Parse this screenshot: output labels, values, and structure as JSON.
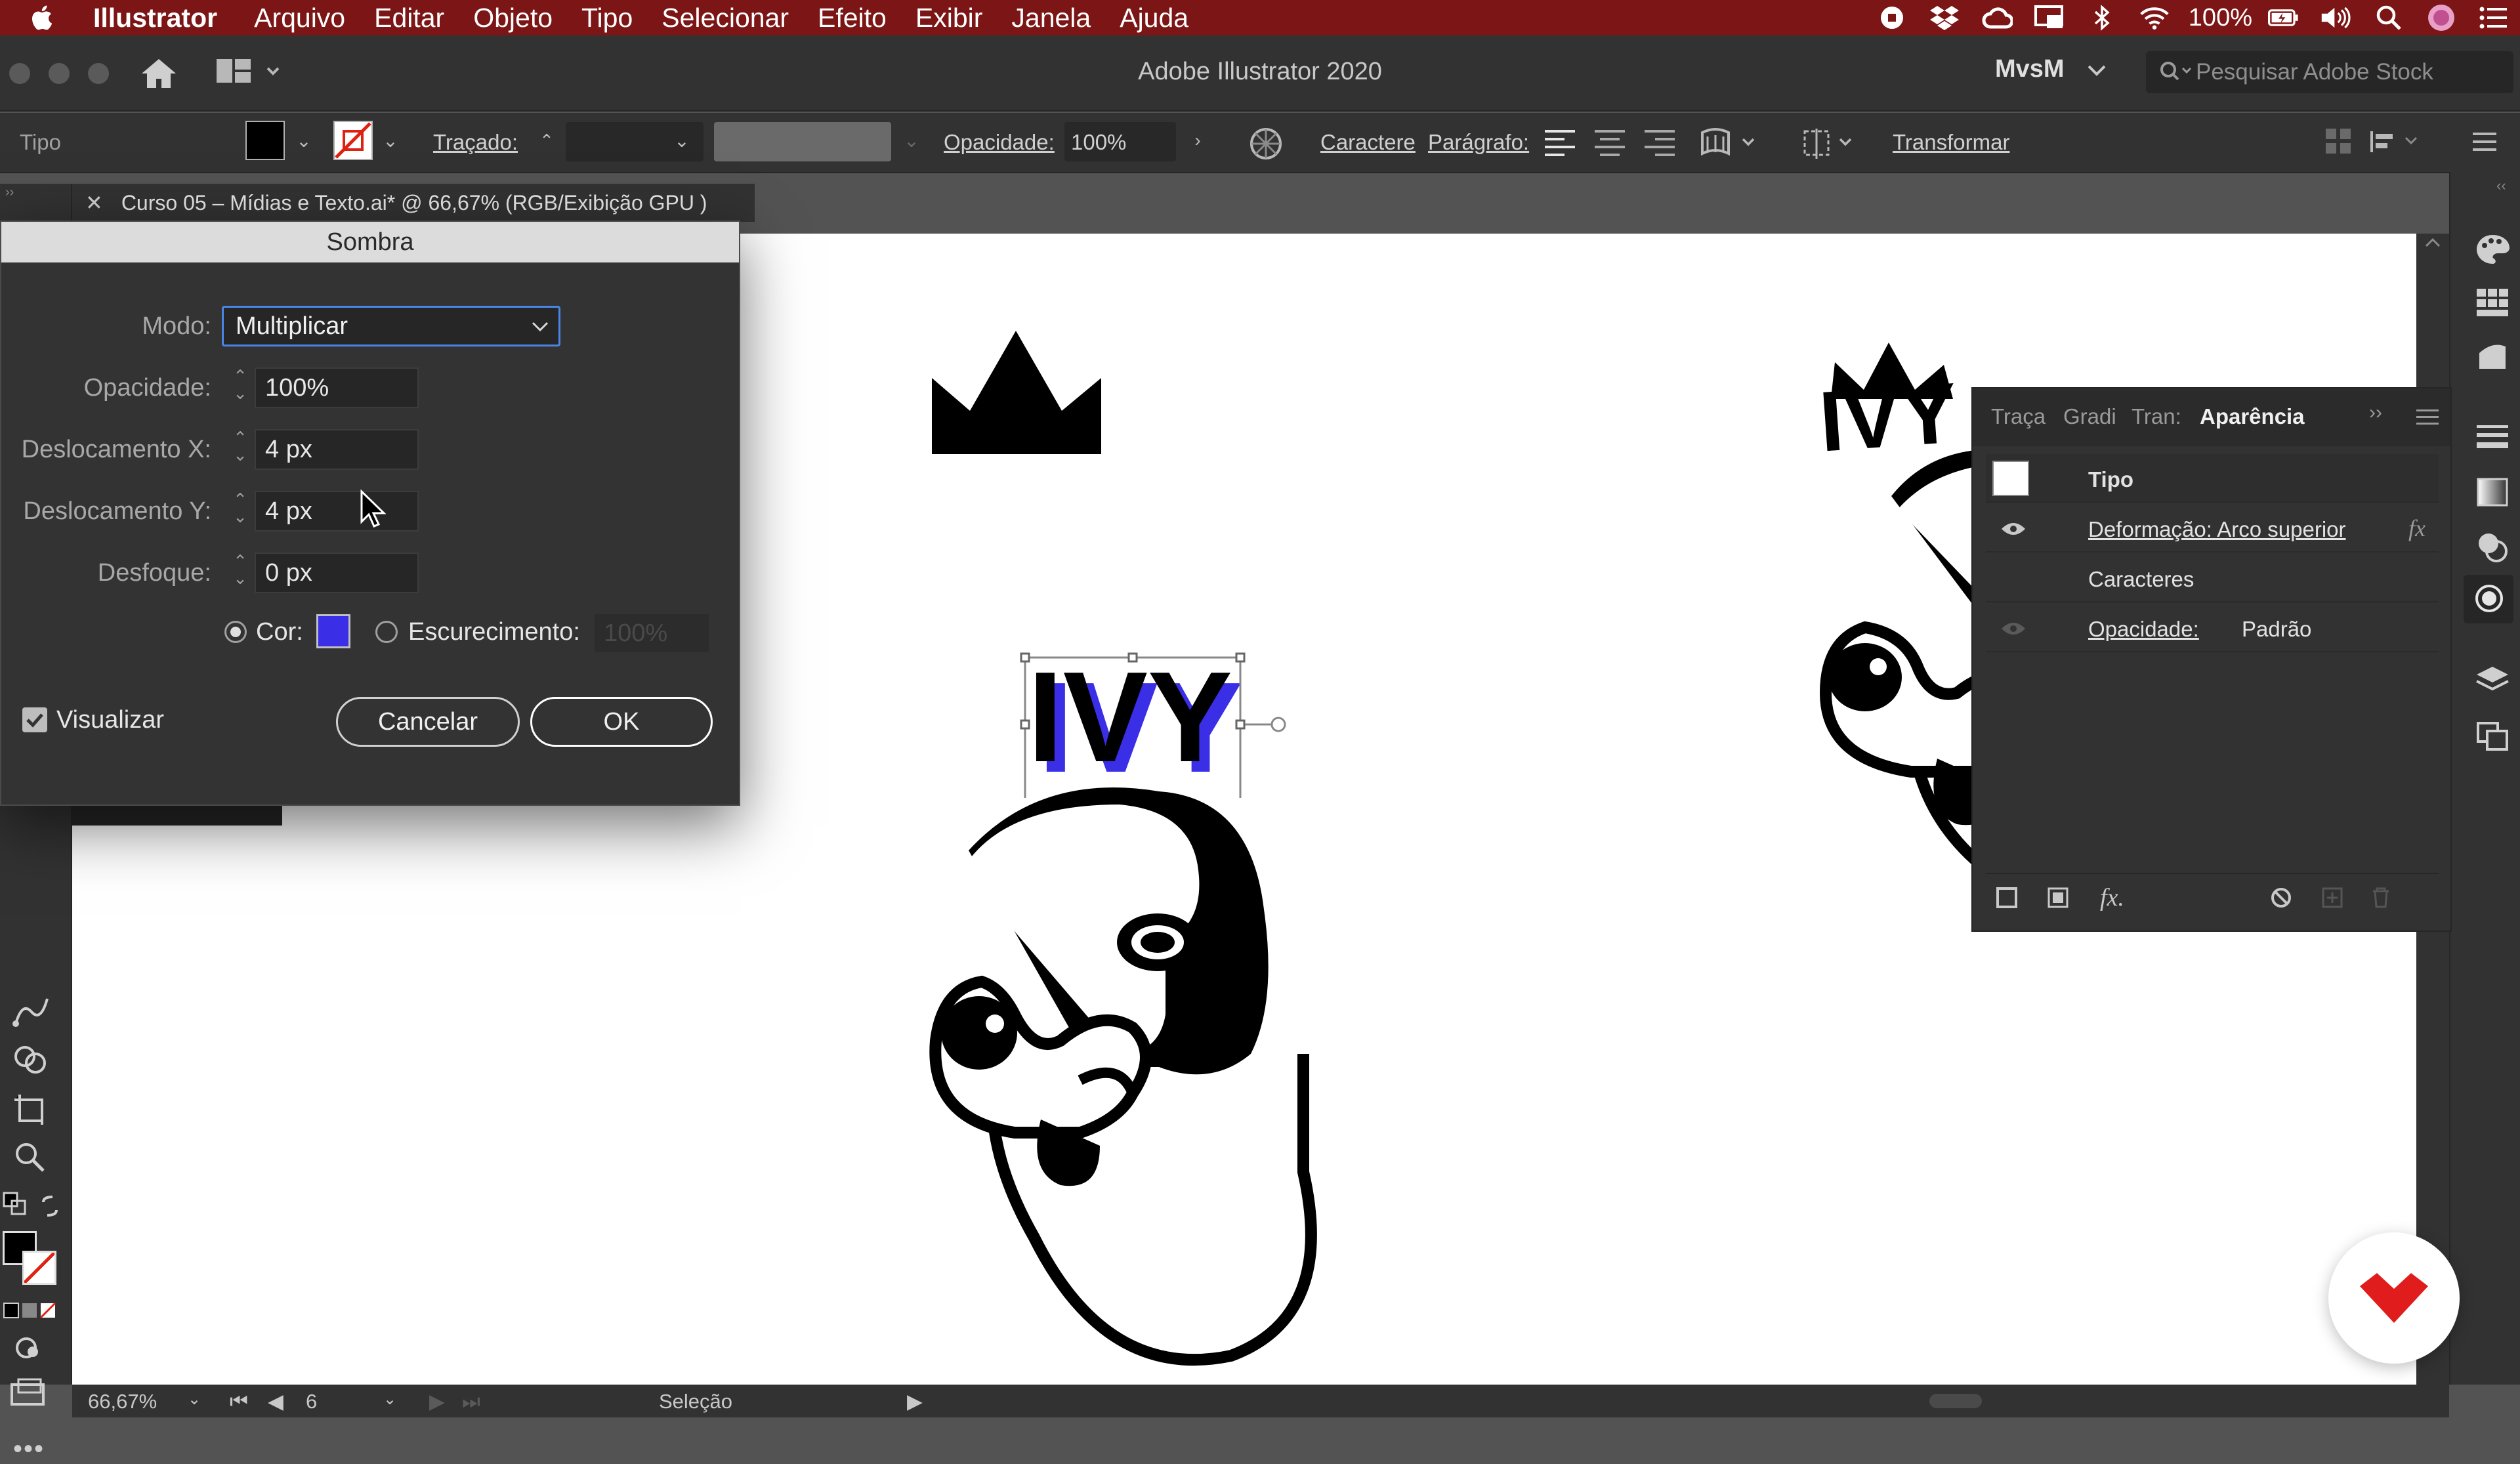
{
  "menubar": {
    "app_name": "Illustrator",
    "items": [
      "Arquivo",
      "Editar",
      "Objeto",
      "Tipo",
      "Selecionar",
      "Efeito",
      "Exibir",
      "Janela",
      "Ajuda"
    ],
    "battery": "100%"
  },
  "appbar": {
    "title": "Adobe Illustrator 2020",
    "workspace": "MvsM",
    "stock_search_placeholder": "Pesquisar Adobe Stock"
  },
  "controlbar": {
    "selection_type": "Tipo",
    "stroke_label": "Traçado:",
    "opacity_label": "Opacidade:",
    "opacity_value": "100%",
    "character_link": "Caractere",
    "paragraph_link": "Parágrafo:",
    "transform_link": "Transformar",
    "fill_color": "#000000"
  },
  "document_tab": {
    "close": "✕",
    "title": "Curso 05 – Mídias e Texto.ai* @ 66,67% (RGB/Exibição GPU )"
  },
  "dialog": {
    "title": "Sombra",
    "mode_label": "Modo:",
    "mode_value": "Multiplicar",
    "opacity_label": "Opacidade:",
    "opacity_value": "100%",
    "offset_x_label": "Deslocamento X:",
    "offset_x_value": "4 px",
    "offset_y_label": "Deslocamento Y:",
    "offset_y_value": "4 px",
    "blur_label": "Desfoque:",
    "blur_value": "0 px",
    "color_label": "Cor:",
    "color_value": "#3a2ee6",
    "color_selected": true,
    "darkness_label": "Escurecimento:",
    "darkness_value": "100%",
    "preview_label": "Visualizar",
    "preview_checked": true,
    "cancel_label": "Cancelar",
    "ok_label": "OK"
  },
  "appearance_panel": {
    "tabs": [
      "Traça",
      "Gradi",
      "Tran:",
      "Aparência"
    ],
    "active_tab": "Aparência",
    "rows": [
      {
        "label": "Tipo"
      },
      {
        "label": "Deformação: Arco superior",
        "fx": "fx"
      },
      {
        "label": "Caracteres"
      },
      {
        "label": "Opacidade:",
        "value": "Padrão"
      }
    ],
    "footer_fx": "fx."
  },
  "artwork": {
    "logo_text": "IVY",
    "shadow_color": "#3a2ee6"
  },
  "statusbar": {
    "zoom": "66,67%",
    "page": "6",
    "tool": "Seleção"
  }
}
